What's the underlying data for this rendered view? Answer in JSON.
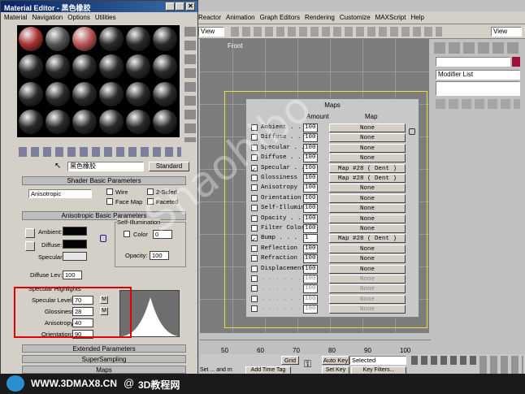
{
  "max_menu": [
    "Reactor",
    "Animation",
    "Graph Editors",
    "Rendering",
    "Customize",
    "MAXScript",
    "Help"
  ],
  "viewport_label": "Front",
  "toolbar": {
    "view_dropdown": "View",
    "view_small": "View"
  },
  "right_panel": {
    "modifier_list": "Modifier List"
  },
  "mat_editor": {
    "title": "Material Editor - 黑色橡胶",
    "menu": [
      "Material",
      "Navigation",
      "Options",
      "Utilities"
    ],
    "material_name": "黑色橡胶",
    "standard_button": "Standard",
    "shader_header": "Shader Basic Parameters",
    "shader_type": "Anisotropic",
    "shader_opts": [
      "Wire",
      "2-Sided",
      "Face Map",
      "Faceted"
    ],
    "aniso_header": "Anisotropic Basic Parameters",
    "ambient": "Ambient:",
    "diffuse": "Diffuse:",
    "specular": "Specular:",
    "self_illum": "Self-Illumination",
    "color": "Color",
    "color_val": "0",
    "opacity_label": "Opacity:",
    "opacity_val": "100",
    "diffuse_lev": "Diffuse Lev:",
    "diffuse_lev_val": "100",
    "spec_header": "Specular Highlights",
    "spec_level": "Specular Level:",
    "spec_level_val": "70",
    "glossiness": "Glossiness:",
    "glossiness_val": "28",
    "anisotropy": "Anisotropy:",
    "anisotropy_val": "40",
    "orientation": "Orientation:",
    "orientation_val": "90",
    "lock_m": "M",
    "extended": "Extended Parameters",
    "supersampling": "SuperSampling",
    "maps": "Maps"
  },
  "maps_panel": {
    "title": "Maps",
    "col_amount": "Amount",
    "col_map": "Map",
    "rows": [
      {
        "name": "Ambient . .",
        "amount": "100",
        "map": "None",
        "checked": false
      },
      {
        "name": "Diffuse . .",
        "amount": "100",
        "map": "None",
        "checked": false
      },
      {
        "name": "Specular . .",
        "amount": "100",
        "map": "None",
        "checked": false
      },
      {
        "name": "Diffuse . .",
        "amount": "100",
        "map": "None",
        "checked": false
      },
      {
        "name": "Specular . .",
        "amount": "100",
        "map": "Map #28  ( Dent )",
        "checked": true
      },
      {
        "name": "Glossiness",
        "amount": "100",
        "map": "Map #28  ( Dent )",
        "checked": false
      },
      {
        "name": "Anisotropy",
        "amount": "100",
        "map": "None",
        "checked": false
      },
      {
        "name": "Orientation",
        "amount": "100",
        "map": "None",
        "checked": false
      },
      {
        "name": "Self-Illumin",
        "amount": "100",
        "map": "None",
        "checked": false
      },
      {
        "name": "Opacity . .",
        "amount": "100",
        "map": "None",
        "checked": false
      },
      {
        "name": "Filter Color",
        "amount": "100",
        "map": "None",
        "checked": false
      },
      {
        "name": "Bump . . .",
        "amount": "1",
        "map": "Map #28  ( Dent )",
        "checked": true
      },
      {
        "name": "Reflection",
        "amount": "100",
        "map": "None",
        "checked": false
      },
      {
        "name": "Refraction",
        "amount": "100",
        "map": "None",
        "checked": false
      },
      {
        "name": "Displacement",
        "amount": "100",
        "map": "None",
        "checked": false
      },
      {
        "name": ". . . . . .",
        "amount": "100",
        "map": "None",
        "checked": false,
        "dim": true
      },
      {
        "name": ". . . . . .",
        "amount": "100",
        "map": "None",
        "checked": false,
        "dim": true
      },
      {
        "name": ". . . . . .",
        "amount": "100",
        "map": "None",
        "checked": false,
        "dim": true
      },
      {
        "name": ". . . . . .",
        "amount": "100",
        "map": "None",
        "checked": false,
        "dim": true
      }
    ]
  },
  "timeline": {
    "ticks": [
      "50",
      "60",
      "70",
      "80",
      "90",
      "100"
    ]
  },
  "bottom": {
    "grid": "Grid",
    "auto_key": "Auto Key",
    "selected": "Selected",
    "set_key": "Set Key",
    "key_filters": "Key Filters...",
    "add_time_tag": "Add Time Tag",
    "status": "Set ... and m"
  },
  "watermark": {
    "url": "WWW.3DMAX8.CN",
    "at": "@",
    "cn": "3D教程网"
  },
  "overlay_text": "Shaohibo",
  "highlight_color": "#e00000"
}
